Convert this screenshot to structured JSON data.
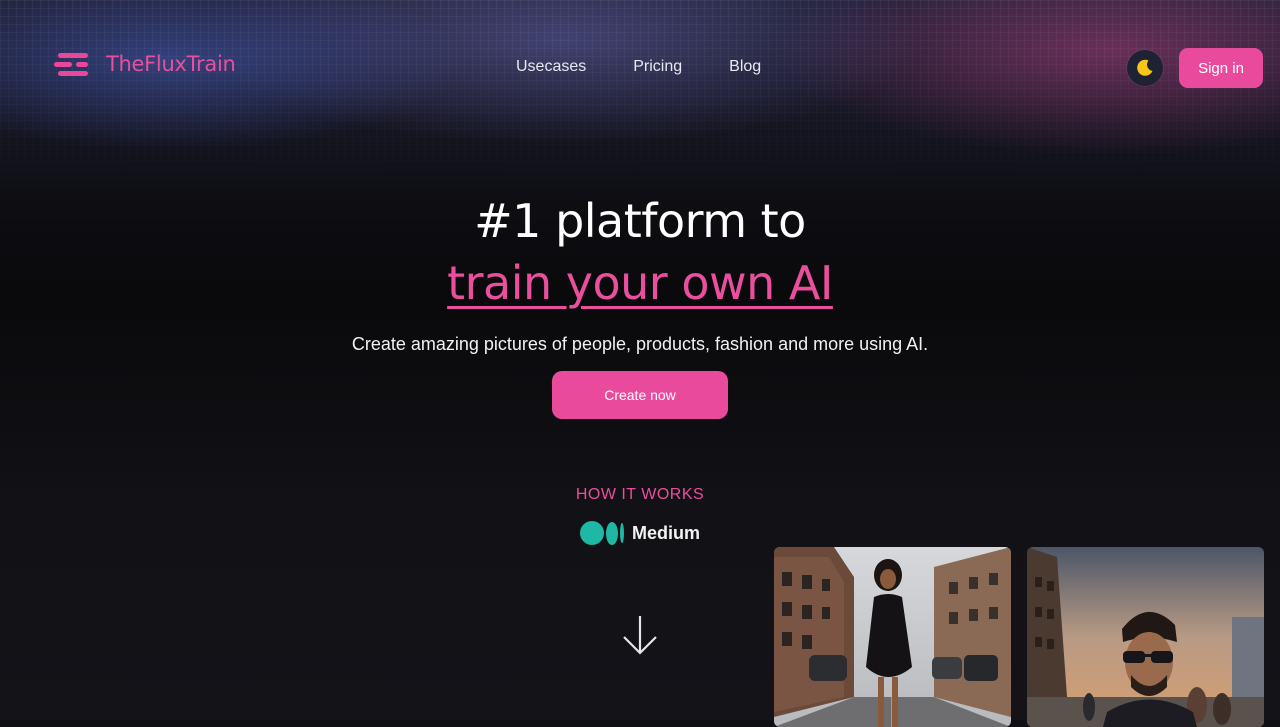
{
  "brand": {
    "name": "TheFluxTrain",
    "logo_icon": "stacked-bars-icon",
    "color": "#ea4f9d"
  },
  "nav": {
    "links": [
      {
        "label": "Usecases"
      },
      {
        "label": "Pricing"
      },
      {
        "label": "Blog"
      }
    ],
    "theme_toggle_icon": "moon-icon",
    "signin_label": "Sign in"
  },
  "hero": {
    "title_line1": "#1 platform to",
    "title_line2": "train your own AI",
    "subtitle": "Create amazing pictures of people, products, fashion and more using AI.",
    "cta_label": "Create now"
  },
  "how_it_works": {
    "label": "HOW IT WORKS",
    "medium_label": "Medium",
    "medium_icon": "medium-logo-icon",
    "arrow_icon": "arrow-down-icon"
  },
  "gallery": {
    "images": [
      {
        "name": "woman-walking-city-street-photo"
      },
      {
        "name": "man-sunglasses-city-sunset-photo"
      }
    ]
  },
  "colors": {
    "accent": "#ea4a9c",
    "background": "#101014",
    "medium_green": "#1fb8a4"
  }
}
